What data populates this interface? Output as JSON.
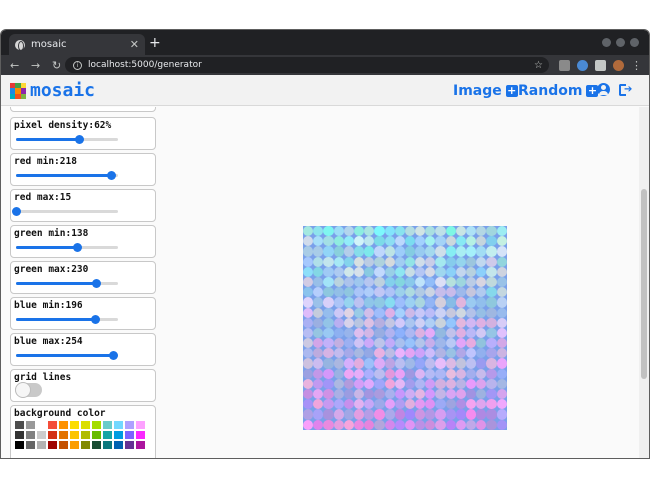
{
  "browser": {
    "tab_title": "mosaic",
    "tab_close": "✕",
    "new_tab": "+",
    "url": "localhost:5000/generator",
    "back": "←",
    "forward": "→",
    "reload": "↻",
    "star": "☆",
    "menu": "⋮"
  },
  "app": {
    "brand": "mosaic",
    "logo_colors": [
      "#e53935",
      "#43a047",
      "#fdd835",
      "#1e88e5",
      "#fb8c00",
      "#8e24aa",
      "#00acc1",
      "#f4511e",
      "#7cb342"
    ],
    "nav": {
      "image": "Image",
      "random": "Random"
    },
    "accent_color": "#1a73e8"
  },
  "controls": {
    "pixel_density": {
      "label": "pixel density:62%",
      "value": 0.62
    },
    "red_min": {
      "label": "red min:218",
      "value": 0.93
    },
    "red_max": {
      "label": "red max:15",
      "value": 0.0
    },
    "green_min": {
      "label": "green min:138",
      "value": 0.6
    },
    "green_max": {
      "label": "green max:230",
      "value": 0.78
    },
    "blue_min": {
      "label": "blue min:196",
      "value": 0.77
    },
    "blue_max": {
      "label": "blue max:254",
      "value": 0.95
    },
    "grid_lines": {
      "label": "grid lines",
      "on": false
    },
    "background_color": {
      "label": "background color",
      "swatches": [
        "#4d4d4d",
        "#999999",
        "#ffffff",
        "#f44e3b",
        "#fe9200",
        "#fcdc00",
        "#dbdf00",
        "#a4dd00",
        "#68ccca",
        "#73d8ff",
        "#aea1ff",
        "#fda1ff",
        "#333333",
        "#808080",
        "#cccccc",
        "#d33115",
        "#e27300",
        "#fcc400",
        "#b0bc00",
        "#68bc00",
        "#16a5a5",
        "#009ce0",
        "#7b64ff",
        "#fa28ff",
        "#000000",
        "#666666",
        "#b3b3b3",
        "#9f0500",
        "#c45100",
        "#fb9e00",
        "#808900",
        "#194d33",
        "#0c797d",
        "#0062b1",
        "#653294",
        "#ab149e"
      ]
    }
  }
}
